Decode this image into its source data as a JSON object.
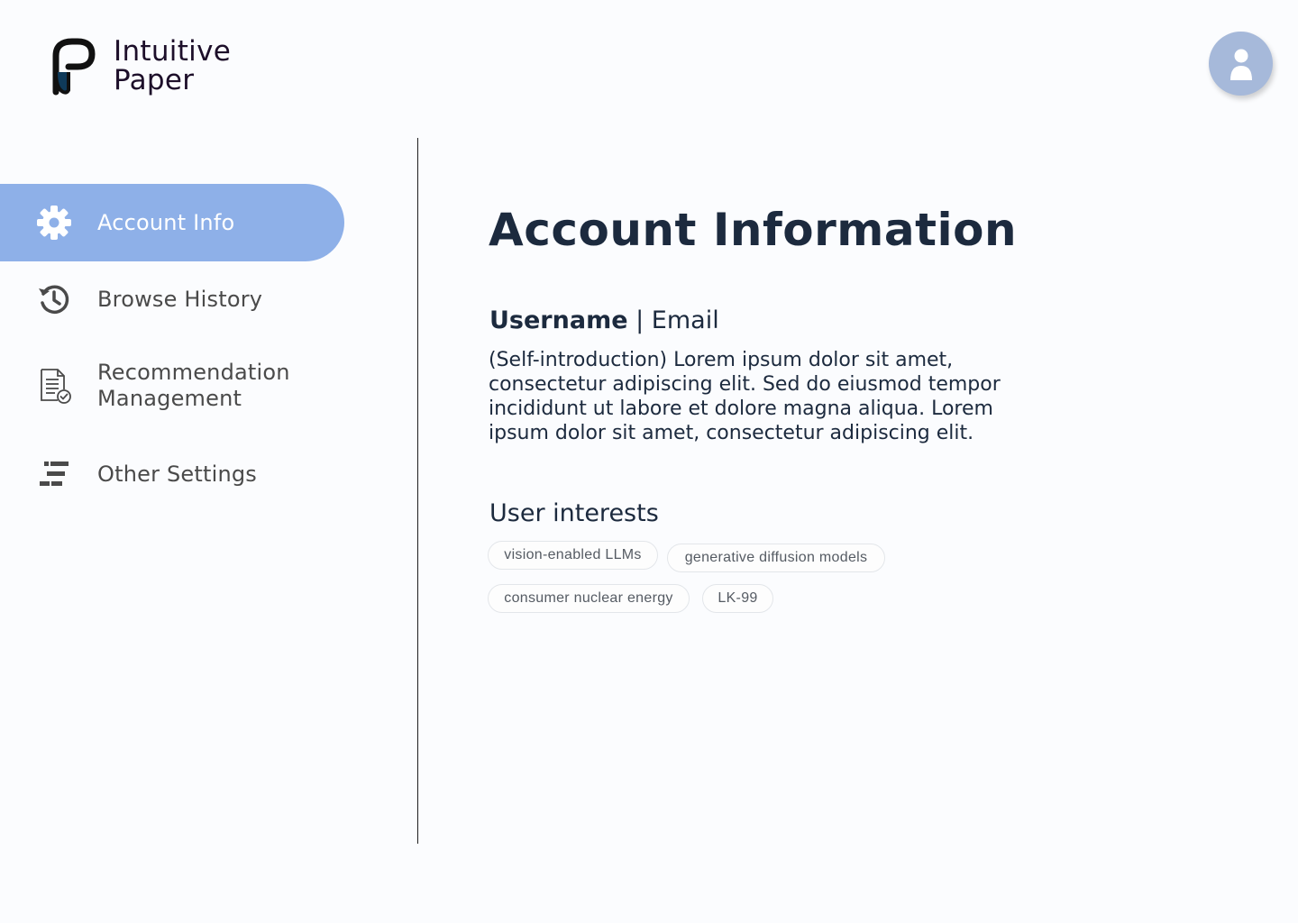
{
  "brand": {
    "name_line1": "Intuitive",
    "name_line2": "Paper",
    "logo_icon": "p-logo-icon"
  },
  "header": {
    "avatar_icon": "user-avatar-icon"
  },
  "sidebar": {
    "items": [
      {
        "label": "Account Info",
        "icon": "gear-icon",
        "active": true
      },
      {
        "label": "Browse History",
        "icon": "history-icon",
        "active": false
      },
      {
        "label": "Recommendation Management",
        "label_line1": "Recommendation",
        "label_line2": "Management",
        "icon": "document-check-icon",
        "active": false
      },
      {
        "label": "Other Settings",
        "icon": "settings-bars-icon",
        "active": false
      }
    ]
  },
  "main": {
    "title": "Account Information",
    "username": "Username",
    "separator": " | ",
    "email": "Email",
    "intro": "(Self-introduction) Lorem ipsum dolor sit amet, consectetur adipiscing elit.  Sed do eiusmod tempor incididunt ut labore et dolore magna aliqua. Lorem ipsum dolor sit amet, consectetur adipiscing elit.",
    "interests_title": "User interests",
    "interests": [
      "vision-enabled LLMs",
      "generative diffusion models",
      "consumer nuclear energy",
      "LK-99"
    ]
  },
  "colors": {
    "accent": "#8eb0e8",
    "text_dark": "#1c2a3e",
    "avatar": "#a6b9da",
    "background": "#fbfcfe"
  }
}
